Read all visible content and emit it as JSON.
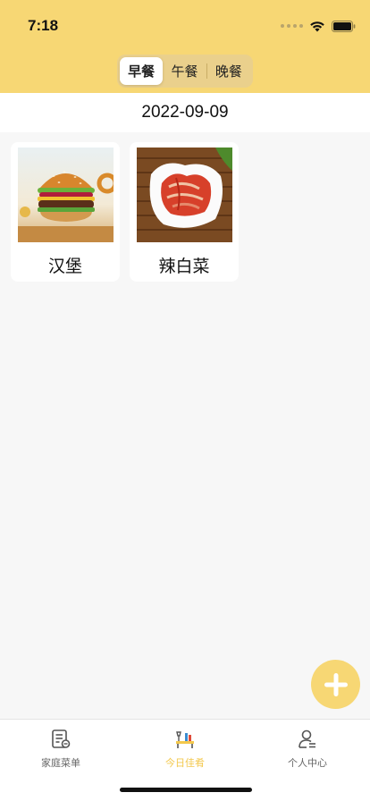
{
  "status_bar": {
    "time": "7:18"
  },
  "meal_tabs": [
    {
      "label": "早餐",
      "active": true
    },
    {
      "label": "午餐",
      "active": false
    },
    {
      "label": "晚餐",
      "active": false
    }
  ],
  "date": "2022-09-09",
  "dishes": [
    {
      "name": "汉堡",
      "image": "burger"
    },
    {
      "name": "辣白菜",
      "image": "kimchi"
    }
  ],
  "add_button": {
    "icon": "plus-icon"
  },
  "tab_bar": [
    {
      "label": "家庭菜单",
      "icon": "menu-list-icon",
      "active": false
    },
    {
      "label": "今日佳肴",
      "icon": "dining-table-icon",
      "active": true
    },
    {
      "label": "个人中心",
      "icon": "user-icon",
      "active": false
    }
  ],
  "colors": {
    "accent": "#f7d774",
    "active_tab": "#f3c84d",
    "background": "#f7f7f7"
  }
}
